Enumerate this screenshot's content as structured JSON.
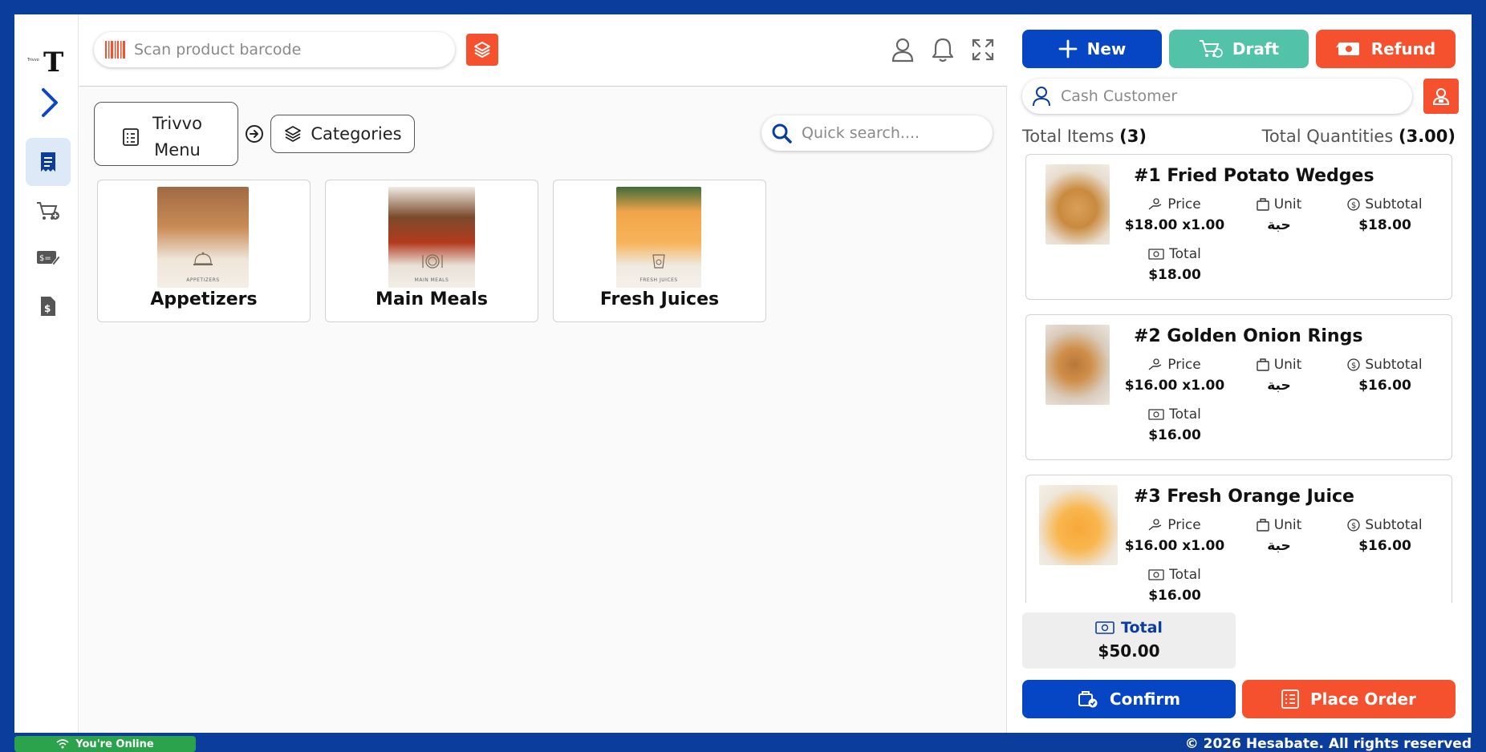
{
  "brand": {
    "logo_small": "Trivvo",
    "logo_letter": "T"
  },
  "topbar": {
    "scan_placeholder": "Scan product barcode"
  },
  "breadcrumb": {
    "menu_label": "Trivvo Menu",
    "categories_label": "Categories"
  },
  "search": {
    "placeholder": "Quick search...."
  },
  "categories": [
    {
      "name": "Appetizers",
      "caption": "APPETIZERS"
    },
    {
      "name": "Main Meals",
      "caption": "MAIN MEALS"
    },
    {
      "name": "Fresh Juices",
      "caption": "FRESH JUICES"
    }
  ],
  "actions": {
    "new": "New",
    "draft": "Draft",
    "refund": "Refund"
  },
  "customer": {
    "placeholder": "Cash Customer"
  },
  "summary": {
    "total_items_label": "Total Items",
    "total_items_value": "(3)",
    "total_qty_label": "Total Quantities",
    "total_qty_value": "(3.00)"
  },
  "cart_labels": {
    "price": "Price",
    "unit": "Unit",
    "subtotal": "Subtotal",
    "total": "Total"
  },
  "cart": [
    {
      "title": "#1 Fried Potato Wedges",
      "price": "$18.00 x1.00",
      "unit": "حبة",
      "subtotal": "$18.00",
      "total": "$18.00"
    },
    {
      "title": "#2 Golden Onion Rings",
      "price": "$16.00 x1.00",
      "unit": "حبة",
      "subtotal": "$16.00",
      "total": "$16.00"
    },
    {
      "title": "#3 Fresh Orange Juice",
      "price": "$16.00 x1.00",
      "unit": "حبة",
      "subtotal": "$16.00",
      "total": "$16.00"
    }
  ],
  "grand_total": {
    "label": "Total",
    "value": "$50.00"
  },
  "footer_actions": {
    "confirm": "Confirm",
    "place_order": "Place Order"
  },
  "status": {
    "online": "You're Online"
  },
  "copyright": "© 2026 Hesabate. All rights reserved",
  "colors": {
    "primary": "#0a3d9c",
    "button_blue": "#0645c4",
    "accent_orange": "#f5512f",
    "draft_green": "#52c3a8",
    "online_green": "#2ba24c"
  }
}
